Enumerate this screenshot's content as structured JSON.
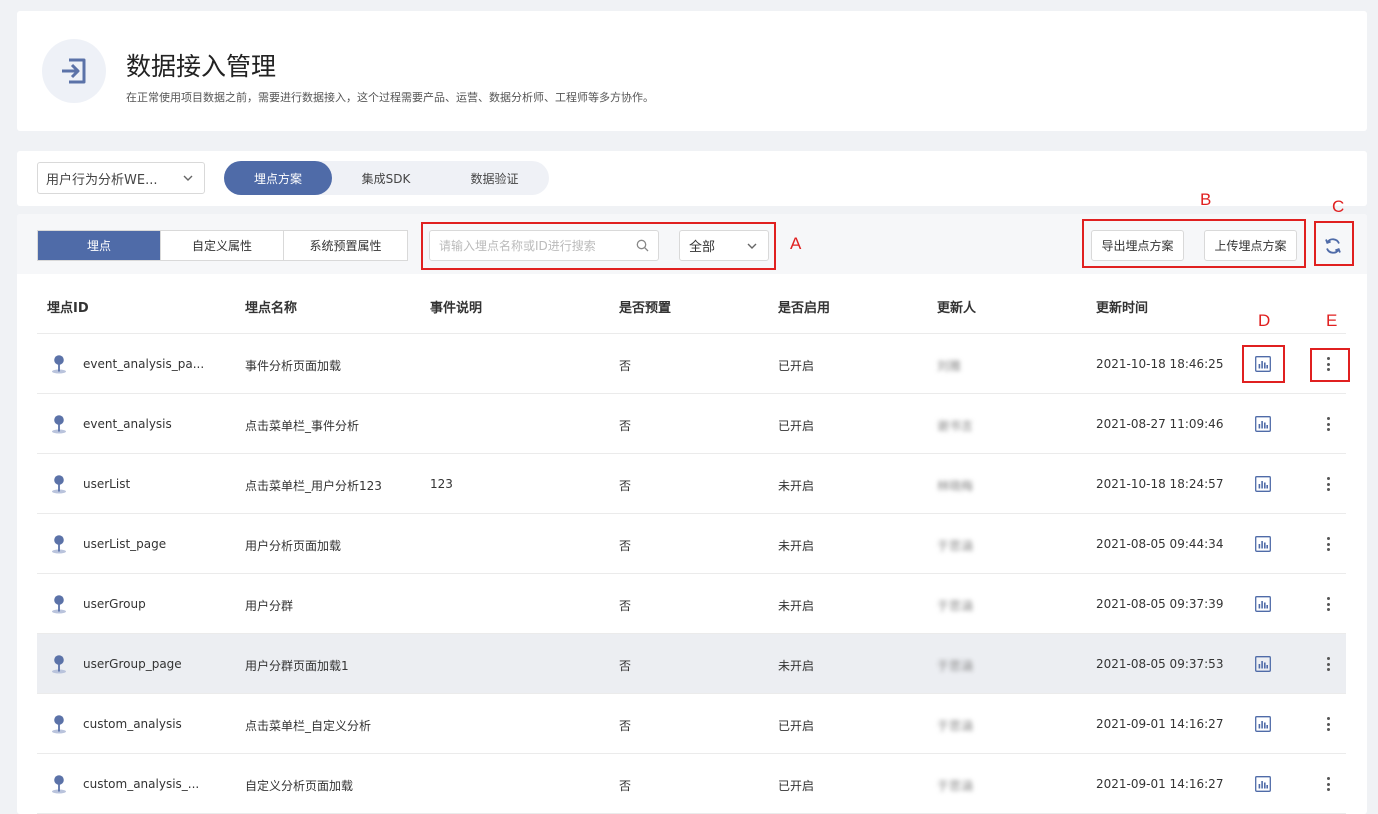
{
  "header": {
    "title": "数据接入管理",
    "subtitle": "在正常使用项目数据之前，需要进行数据接入，这个过程需要产品、运营、数据分析师、工程师等多方协作。"
  },
  "nav": {
    "project_select": "用户行为分析WE...",
    "tabs": [
      {
        "label": "埋点方案",
        "active": true
      },
      {
        "label": "集成SDK",
        "active": false
      },
      {
        "label": "数据验证",
        "active": false
      }
    ]
  },
  "toolbar": {
    "tabs": [
      {
        "label": "埋点",
        "active": true
      },
      {
        "label": "自定义属性",
        "active": false
      },
      {
        "label": "系统预置属性",
        "active": false
      }
    ],
    "search_placeholder": "请输入埋点名称或ID进行搜索",
    "filter_value": "全部",
    "export_label": "导出埋点方案",
    "upload_label": "上传埋点方案"
  },
  "annotations": {
    "a": "A",
    "b": "B",
    "c": "C",
    "d": "D",
    "e": "E"
  },
  "table": {
    "columns": [
      "埋点ID",
      "埋点名称",
      "事件说明",
      "是否预置",
      "是否启用",
      "更新人",
      "更新时间"
    ],
    "rows": [
      {
        "id": "event_analysis_pa...",
        "name": "事件分析页面加载",
        "desc": "",
        "preset": "否",
        "enabled": "已开启",
        "updater": "刘雅",
        "time": "2021-10-18 18:46:25"
      },
      {
        "id": "event_analysis",
        "name": "点击菜单栏_事件分析",
        "desc": "",
        "preset": "否",
        "enabled": "已开启",
        "updater": "谢书言",
        "time": "2021-08-27 11:09:46"
      },
      {
        "id": "userList",
        "name": "点击菜单栏_用户分析123",
        "desc": "123",
        "preset": "否",
        "enabled": "未开启",
        "updater": "林晓梅",
        "time": "2021-10-18 18:24:57"
      },
      {
        "id": "userList_page",
        "name": "用户分析页面加载",
        "desc": "",
        "preset": "否",
        "enabled": "未开启",
        "updater": "于思涵",
        "time": "2021-08-05 09:44:34"
      },
      {
        "id": "userGroup",
        "name": "用户分群",
        "desc": "",
        "preset": "否",
        "enabled": "未开启",
        "updater": "于思涵",
        "time": "2021-08-05 09:37:39"
      },
      {
        "id": "userGroup_page",
        "name": "用户分群页面加载1",
        "desc": "",
        "preset": "否",
        "enabled": "未开启",
        "updater": "于思涵",
        "time": "2021-08-05 09:37:53"
      },
      {
        "id": "custom_analysis",
        "name": "点击菜单栏_自定义分析",
        "desc": "",
        "preset": "否",
        "enabled": "已开启",
        "updater": "于思涵",
        "time": "2021-09-01 14:16:27"
      },
      {
        "id": "custom_analysis_...",
        "name": "自定义分析页面加载",
        "desc": "",
        "preset": "否",
        "enabled": "已开启",
        "updater": "于思涵",
        "time": "2021-09-01 14:16:27"
      }
    ]
  },
  "icons": {
    "header": "login-arrow-icon",
    "row": "location-pin-icon",
    "chart": "bar-chart-icon",
    "more": "more-vertical-icon",
    "refresh": "refresh-icon",
    "search": "search-icon"
  },
  "colors": {
    "primary": "#4f6ba8",
    "annotation": "#e02020",
    "row_highlight": "#eceef2"
  }
}
